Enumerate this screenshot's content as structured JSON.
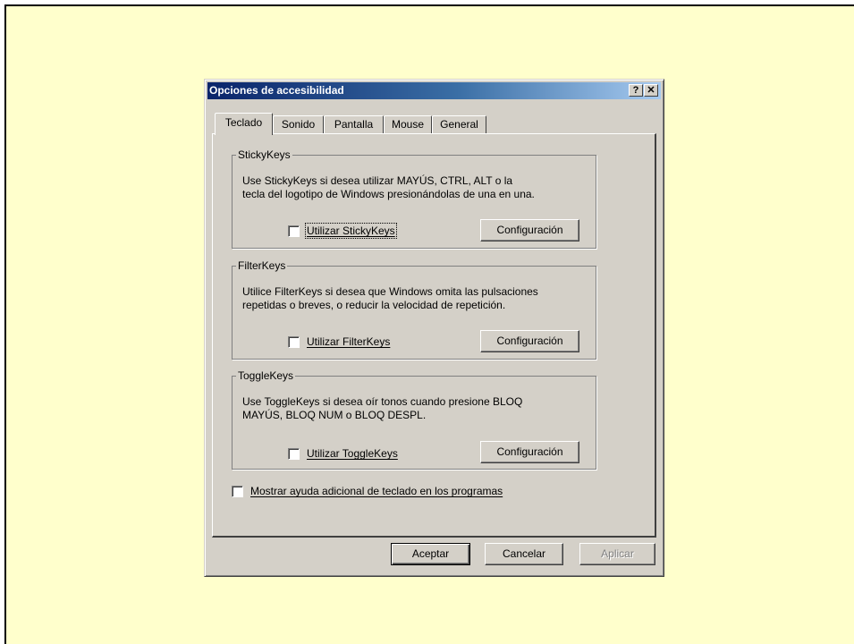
{
  "dialog": {
    "title": "Opciones de accesibilidad",
    "help_button": "?",
    "close_button": "✕"
  },
  "tabs": [
    {
      "label": "Teclado",
      "active": true
    },
    {
      "label": "Sonido",
      "active": false
    },
    {
      "label": "Pantalla",
      "active": false
    },
    {
      "label": "Mouse",
      "active": false
    },
    {
      "label": "General",
      "active": false
    }
  ],
  "groups": {
    "stickykeys": {
      "title": "StickyKeys",
      "description": "Use StickyKeys si desea utilizar MAYÚS, CTRL, ALT o la\ntecla del logotipo de Windows presionándolas de una en una.",
      "checkbox_prefix": "",
      "checkbox_label": "Utilizar StickyKeys",
      "checked": false,
      "button": "Configuración"
    },
    "filterkeys": {
      "title": "FilterKeys",
      "description": "Utilice FilterKeys si desea que Windows omita las pulsaciones\nrepetidas o breves, o reducir la velocidad de repetición.",
      "checkbox_label": "Utilizar FilterKeys",
      "checked": false,
      "button": "Configuración"
    },
    "togglekeys": {
      "title": "ToggleKeys",
      "description": "Use ToggleKeys si desea oír tonos cuando presione BLOQ\nMAYÚS, BLOQ NUM o BLOQ DESPL.",
      "checkbox_label": "Utilizar ToggleKeys",
      "checked": false,
      "button": "Configuración"
    }
  },
  "extra_help": {
    "label": "Mostrar ayuda adicional de teclado en los programas",
    "checked": false
  },
  "footer": {
    "ok": "Aceptar",
    "cancel": "Cancelar",
    "apply": "Aplicar"
  }
}
